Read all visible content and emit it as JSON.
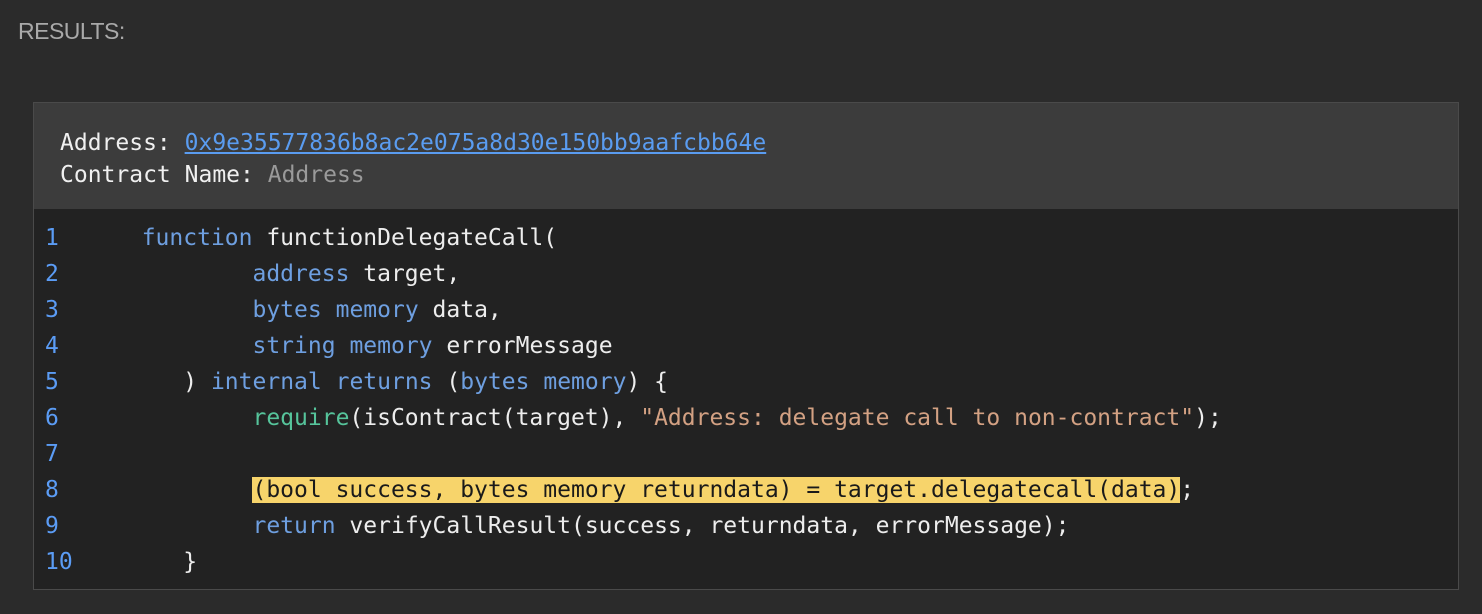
{
  "results_label": "RESULTS:",
  "meta": {
    "address_label": "Address: ",
    "address_value": "0x9e35577836b8ac2e075a8d30e150bb9aafcbb64e",
    "contract_name_label": "Contract Name: ",
    "contract_name_value": "Address"
  },
  "code": {
    "lines": [
      {
        "n": "1",
        "tokens": [
          {
            "t": "function",
            "c": "kw"
          },
          {
            "t": " functionDelegateCall("
          }
        ],
        "indent": "  "
      },
      {
        "n": "2",
        "tokens": [
          {
            "t": "address",
            "c": "kw"
          },
          {
            "t": " target,"
          }
        ],
        "indent": "          "
      },
      {
        "n": "3",
        "tokens": [
          {
            "t": "bytes",
            "c": "kw"
          },
          {
            "t": " "
          },
          {
            "t": "memory",
            "c": "kw"
          },
          {
            "t": " data,"
          }
        ],
        "indent": "          "
      },
      {
        "n": "4",
        "tokens": [
          {
            "t": "string",
            "c": "kw"
          },
          {
            "t": " "
          },
          {
            "t": "memory",
            "c": "kw"
          },
          {
            "t": " errorMessage"
          }
        ],
        "indent": "          "
      },
      {
        "n": "5",
        "tokens": [
          {
            "t": ") "
          },
          {
            "t": "internal",
            "c": "kw"
          },
          {
            "t": " "
          },
          {
            "t": "returns",
            "c": "kw"
          },
          {
            "t": " ("
          },
          {
            "t": "bytes",
            "c": "kw"
          },
          {
            "t": " "
          },
          {
            "t": "memory",
            "c": "kw"
          },
          {
            "t": ") {"
          }
        ],
        "indent": "     "
      },
      {
        "n": "6",
        "tokens": [
          {
            "t": "require",
            "c": "fn"
          },
          {
            "t": "(isContract(target), "
          },
          {
            "t": "\"Address: delegate call to non-contract\"",
            "c": "str"
          },
          {
            "t": ");"
          }
        ],
        "indent": "          "
      },
      {
        "n": "7",
        "tokens": [],
        "indent": ""
      },
      {
        "n": "8",
        "tokens": [
          {
            "t": "(bool success, bytes memory returndata) = target.delegatecall(data)",
            "c": "hl"
          },
          {
            "t": ";"
          }
        ],
        "indent": "          "
      },
      {
        "n": "9",
        "tokens": [
          {
            "t": "return",
            "c": "kw"
          },
          {
            "t": " verifyCallResult(success, returndata, errorMessage);"
          }
        ],
        "indent": "          "
      },
      {
        "n": "10",
        "tokens": [
          {
            "t": "}"
          }
        ],
        "indent": "     "
      }
    ]
  },
  "colors": {
    "background": "#2b2b2b",
    "meta_background": "#3c3c3c",
    "code_background": "#222222",
    "link": "#5a9cf0",
    "line_number": "#5b9cf5",
    "keyword": "#6e9fe0",
    "function": "#56c49b",
    "string": "#d3a183",
    "highlight": "#f7d46b"
  }
}
